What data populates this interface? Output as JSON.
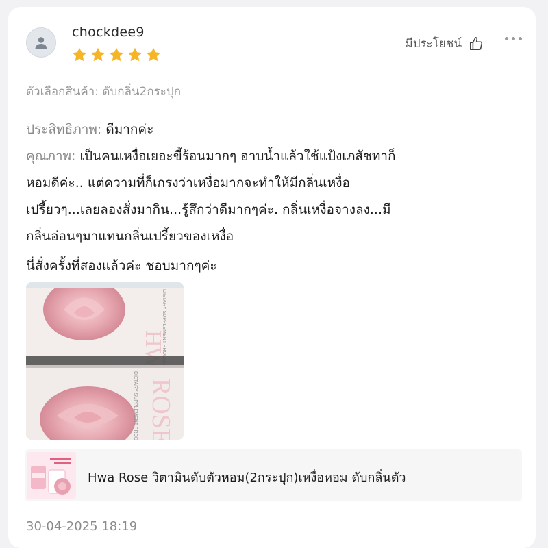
{
  "review": {
    "username": "chockdee9",
    "rating": 5,
    "helpful_label": "มีประโยชน์",
    "variant_label": "ตัวเลือกสินค้า:",
    "variant_value": "ดับกลิ่น2กระปุก",
    "effectiveness_label": "ประสิทธิภาพ:",
    "effectiveness_value": "ดีมากค่ะ",
    "quality_label": "คุณภาพ:",
    "quality_lines": [
      "เป็นคนเหงื่อเยอะขี้ร้อนมากๆ  อาบน้ำแล้วใช้แป้งเภสัชทาก็",
      "หอมดีค่ะ.. แต่ความที่ก็เกรงว่าเหงื่อมากจะทำให้มีกลิ่นเหงื่อ",
      "เปรี้ยวๆ...เลยลองสั่งมากิน...รู้สึกว่าดีมากๆค่ะ.  กลิ่นเหงื่อจางลง...มี",
      "กลิ่นอ่อนๆมาแทนกลิ่นเปรี้ยวของเหงื่อ"
    ],
    "closing_line": "นี่สั่งครั้งที่สองแล้วค่ะ   ชอบมากๆค่ะ",
    "photo_text": {
      "brand_top": "HWA",
      "brand_bottom": "ROSE",
      "product_type": "DIETARY SUPPLEMENT PRODUCT"
    },
    "product": {
      "title": "Hwa Rose วิตามินดับตัวหอม(2กระปุก)เหงื่อหอม ดับกลิ่นตัว"
    },
    "date": "30-04-2025 18:19"
  },
  "colors": {
    "star": "#f6b526",
    "text": "#1d1d1d",
    "muted": "#8a8a8a",
    "rose": "#e9aeb7"
  },
  "icons": {
    "avatar": "user-icon",
    "helpful": "thumbs-up-icon",
    "more": "more-icon"
  }
}
